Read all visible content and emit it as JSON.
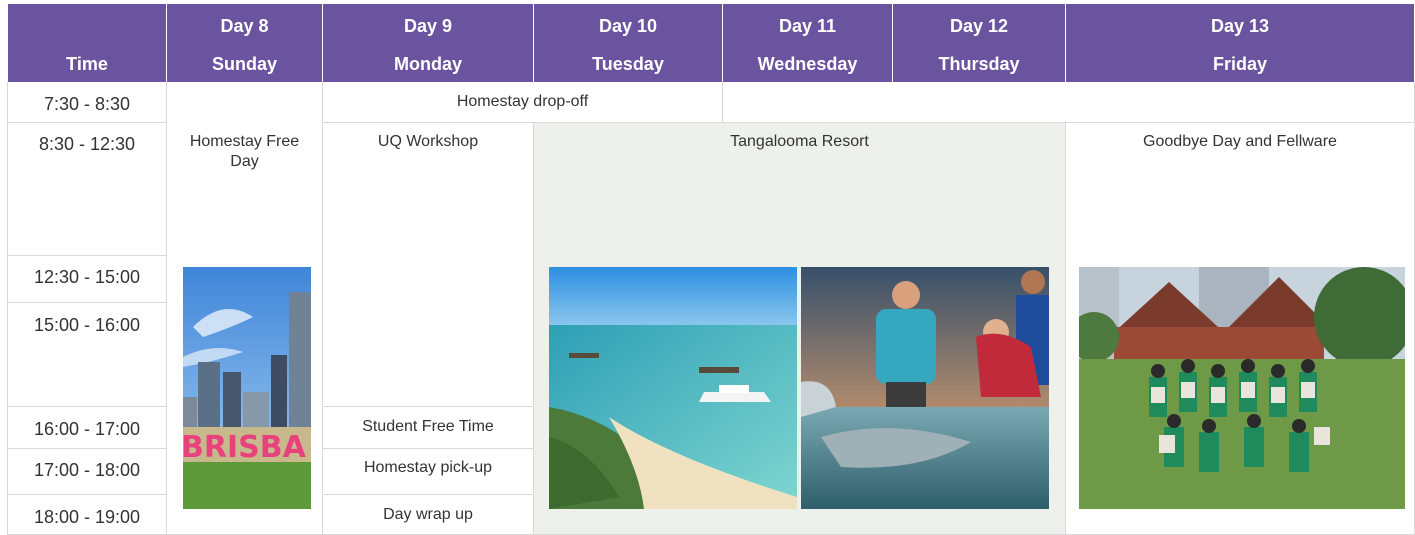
{
  "header": {
    "time_label": "Time",
    "days": [
      {
        "day": "Day 8",
        "weekday": "Sunday"
      },
      {
        "day": "Day 9",
        "weekday": "Monday"
      },
      {
        "day": "Day 10",
        "weekday": "Tuesday"
      },
      {
        "day": "Day 11",
        "weekday": "Wednesday"
      },
      {
        "day": "Day 12",
        "weekday": "Thursday"
      },
      {
        "day": "Day 13",
        "weekday": "Friday"
      }
    ]
  },
  "times": [
    "7:30 - 8:30",
    "8:30 - 12:30",
    "12:30 - 15:00",
    "15:00 - 16:00",
    "16:00 - 17:00",
    "17:00 - 18:00",
    "18:00 - 19:00"
  ],
  "activities": {
    "homestay_dropoff": "Homestay drop-off",
    "homestay_free_day": "Homestay Free Day",
    "uq_workshop": "UQ Workshop",
    "tangalooma": "Tangalooma Resort",
    "goodbye": "Goodbye Day and Fellware",
    "student_free_time": "Student Free Time",
    "homestay_pickup": "Homestay pick-up",
    "day_wrap_up": "Day wrap up"
  },
  "photos": {
    "brisbane_sign_text": "BRISBA"
  },
  "colors": {
    "header_bg": "#6a549f",
    "header_text": "#ffffff",
    "tangalooma_bg": "#eef0ec",
    "grid_line": "#d9d9d9"
  }
}
